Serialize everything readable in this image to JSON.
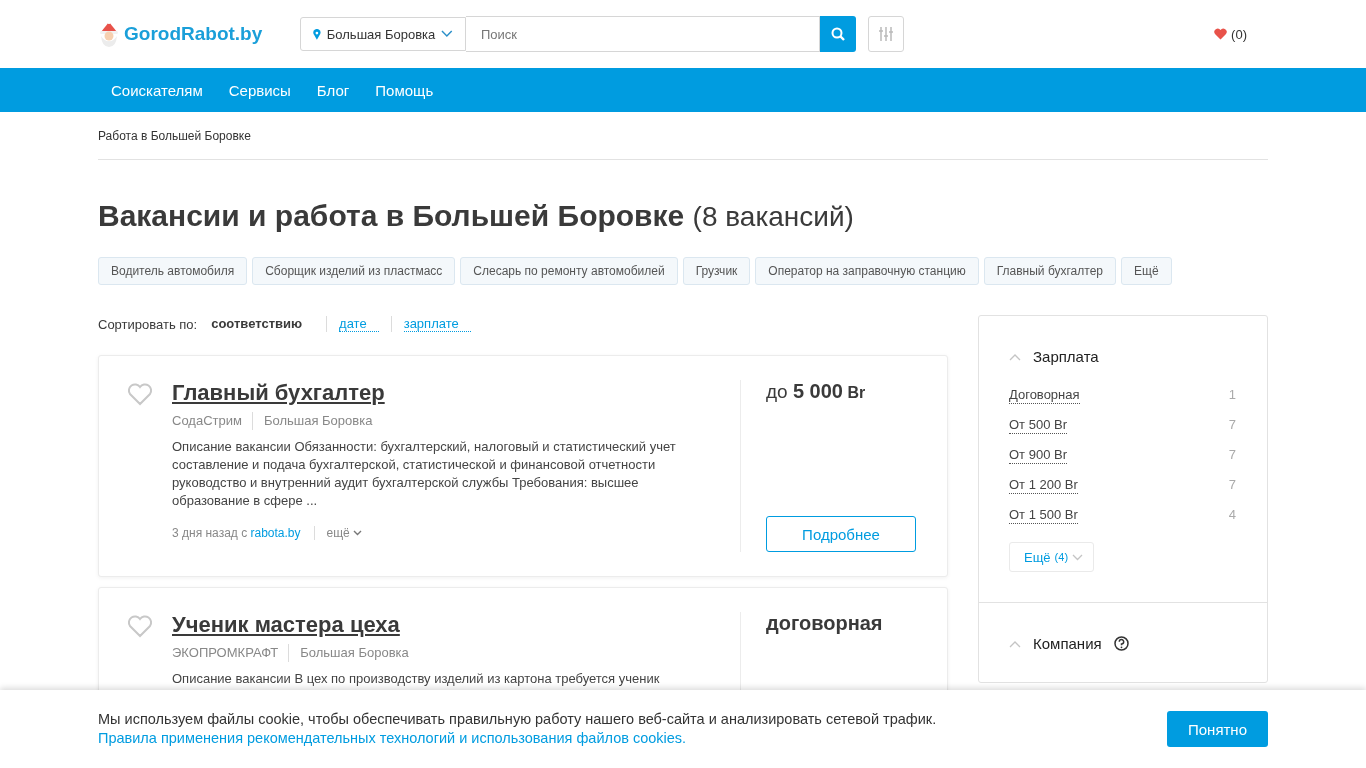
{
  "header": {
    "logo": "GorodRabot.by",
    "location": "Большая Боровка",
    "search_placeholder": "Поиск",
    "favorites": "(0)"
  },
  "nav": [
    "Соискателям",
    "Сервисы",
    "Блог",
    "Помощь"
  ],
  "breadcrumb": "Работа в Большей Боровке",
  "heading": {
    "title": "Вакансии и работа в Большей Боровке",
    "count": "(8 вакансий)"
  },
  "tags": [
    "Водитель автомобиля",
    "Сборщик изделий из пластмасс",
    "Слесарь по ремонту автомобилей",
    "Грузчик",
    "Оператор на заправочную станцию",
    "Главный бухгалтер",
    "Ещё"
  ],
  "sort": {
    "label": "Сортировать по:",
    "options": [
      {
        "label": "соответствию",
        "selected": true
      },
      {
        "label": "дате",
        "selected": false
      },
      {
        "label": "зарплате",
        "selected": false
      }
    ]
  },
  "jobs": [
    {
      "title": "Главный бухгалтер",
      "company": "СодаСтрим",
      "location": "Большая Боровка",
      "description": "Описание вакансии Обязанности: бухгалтерский, налоговый и статистический учет составление и подача бухгалтерской, статистической и финансовой отчетности руководство и внутренний аудит бухгалтерской службы Требования: высшее образование в сфере ...",
      "date": "3 дня назад с",
      "source": "rabota.by",
      "more": "ещё",
      "salary_prefix": "до",
      "salary": "5 000",
      "currency": "Br",
      "button": "Подробнее"
    },
    {
      "title": "Ученик мастера цеха",
      "company": "ЭКОПРОМКРАФТ",
      "location": "Большая Боровка",
      "description": "Описание вакансии В цех по производству изделий из картона требуется ученик",
      "salary": "договорная"
    }
  ],
  "filters": [
    {
      "title": "Зарплата",
      "expanded": true,
      "help": false,
      "items": [
        {
          "label": "Договорная",
          "count": "1"
        },
        {
          "label": "От 500 Br",
          "count": "7"
        },
        {
          "label": "От 900 Br",
          "count": "7"
        },
        {
          "label": "От 1 200 Br",
          "count": "7"
        },
        {
          "label": "От 1 500 Br",
          "count": "4"
        }
      ],
      "more": "Ещё",
      "more_count": "(4)"
    },
    {
      "title": "Компания",
      "expanded": true,
      "help": true
    }
  ],
  "cookie": {
    "text": "Мы используем файлы cookie, чтобы обеспечивать правильную работу нашего веб-сайта и анализировать сетевой трафик.",
    "link": "Правила применения рекомендательных технологий и использования файлов cookies.",
    "button": "Понятно"
  }
}
